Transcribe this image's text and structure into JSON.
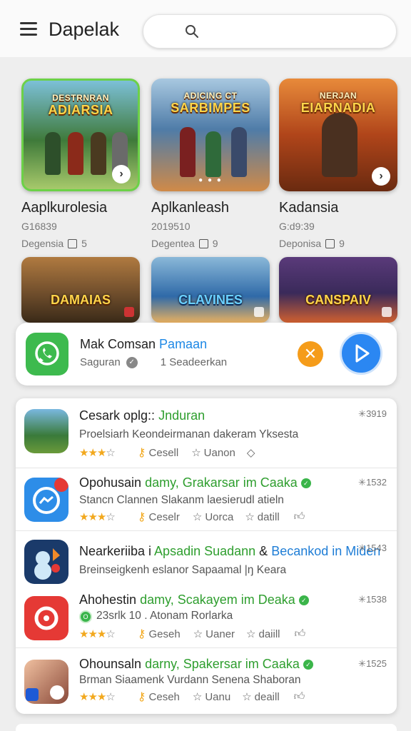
{
  "header": {
    "title": "Dapelak",
    "search_placeholder": ""
  },
  "featured": [
    {
      "thumb_title": "ADIARSIA",
      "thumb_subtitle": "DESTRNRAN",
      "name": "Aaplkurolesia",
      "code": "G16839",
      "meta": "Degensia",
      "count": "5",
      "colors": [
        "#3f7a3a",
        "#a7c96b"
      ],
      "selected": true
    },
    {
      "thumb_title": "SARBIMPES",
      "thumb_subtitle": "ADICING CT",
      "name": "Aplkanleash",
      "code": "2019510",
      "meta": "Degentea",
      "count": "9",
      "colors": [
        "#4f7ca8",
        "#d08a48"
      ],
      "selected": false
    },
    {
      "thumb_title": "EIARNADIA",
      "thumb_subtitle": "NERJAN",
      "name": "Kadansia",
      "code": "G:d9:39",
      "meta": "Deponisa",
      "count": "9",
      "colors": [
        "#b0451a",
        "#f0a040"
      ],
      "selected": false
    }
  ],
  "featured_row2": [
    {
      "thumb_title": "DAMAIAS",
      "colors": [
        "#6a4a2a",
        "#e0a050"
      ]
    },
    {
      "thumb_title": "CLAVINES",
      "colors": [
        "#2f6aa8",
        "#e8b060"
      ]
    },
    {
      "thumb_title": "CANSPAIV",
      "colors": [
        "#3a2a5a",
        "#d06030"
      ]
    }
  ],
  "notification": {
    "title_main": "Mak Comsan",
    "title_accent": "Pamaan",
    "sender": "Saguran",
    "detail": "1 Seadeerkan"
  },
  "list": [
    {
      "title_pre": "Cesark oplg:: ",
      "title_g": "Jnduran",
      "title_mid": "",
      "title_b": "",
      "desc": "Proelsiarh Keondeirmanan dakeram Yksesta",
      "key_label": "Cesell",
      "like_label": "Uanon",
      "extra": "",
      "num": "3919",
      "stars": "★★★",
      "star_empty": "☆"
    },
    {
      "title_pre": "Opohusain ",
      "title_g": "damy, Grakarsar im Caaka",
      "title_mid": "",
      "title_b": "",
      "desc": "Stancn Clannen Slakanm laesierudl atieln",
      "key_label": "Ceselr",
      "like_label": "Uorca",
      "extra": "datill",
      "num": "1532",
      "stars": "★★★",
      "star_empty": "☆"
    },
    {
      "title_pre": "Nearkeriiba i ",
      "title_g": "Apsadin Suadann",
      "title_mid": " & ",
      "title_b": "Becankod in Miden",
      "desc": "Breinseigkenh eslanor Sapaamal |ŋ Keara",
      "key_label": "",
      "like_label": "",
      "extra": "",
      "num": "1543",
      "stars": "",
      "star_empty": ""
    },
    {
      "title_pre": "Ahohestin ",
      "title_g": "damy, Scakayem im Deaka",
      "title_mid": "",
      "title_b": "",
      "desc": "23srlk   10 . Atonam Rorlarka",
      "key_label": "Geseh",
      "like_label": "Uaner",
      "extra": "daiill",
      "num": "1538",
      "stars": "★★★",
      "star_empty": "☆"
    },
    {
      "title_pre": "Ohounsaln ",
      "title_g": "darny, Spakersar im Caaka",
      "title_mid": "",
      "title_b": "",
      "desc": "Brman Siaamenk Vurdann Senena Shaboran",
      "key_label": "Ceseh",
      "like_label": "Uanu",
      "extra": "deaill",
      "num": "1525",
      "stars": "★★★",
      "star_empty": "☆"
    }
  ],
  "badge_letter": "O",
  "icons": {
    "menu": "hamburger-menu-icon",
    "search": "search-icon",
    "close": "close-icon",
    "play": "play-icon"
  }
}
